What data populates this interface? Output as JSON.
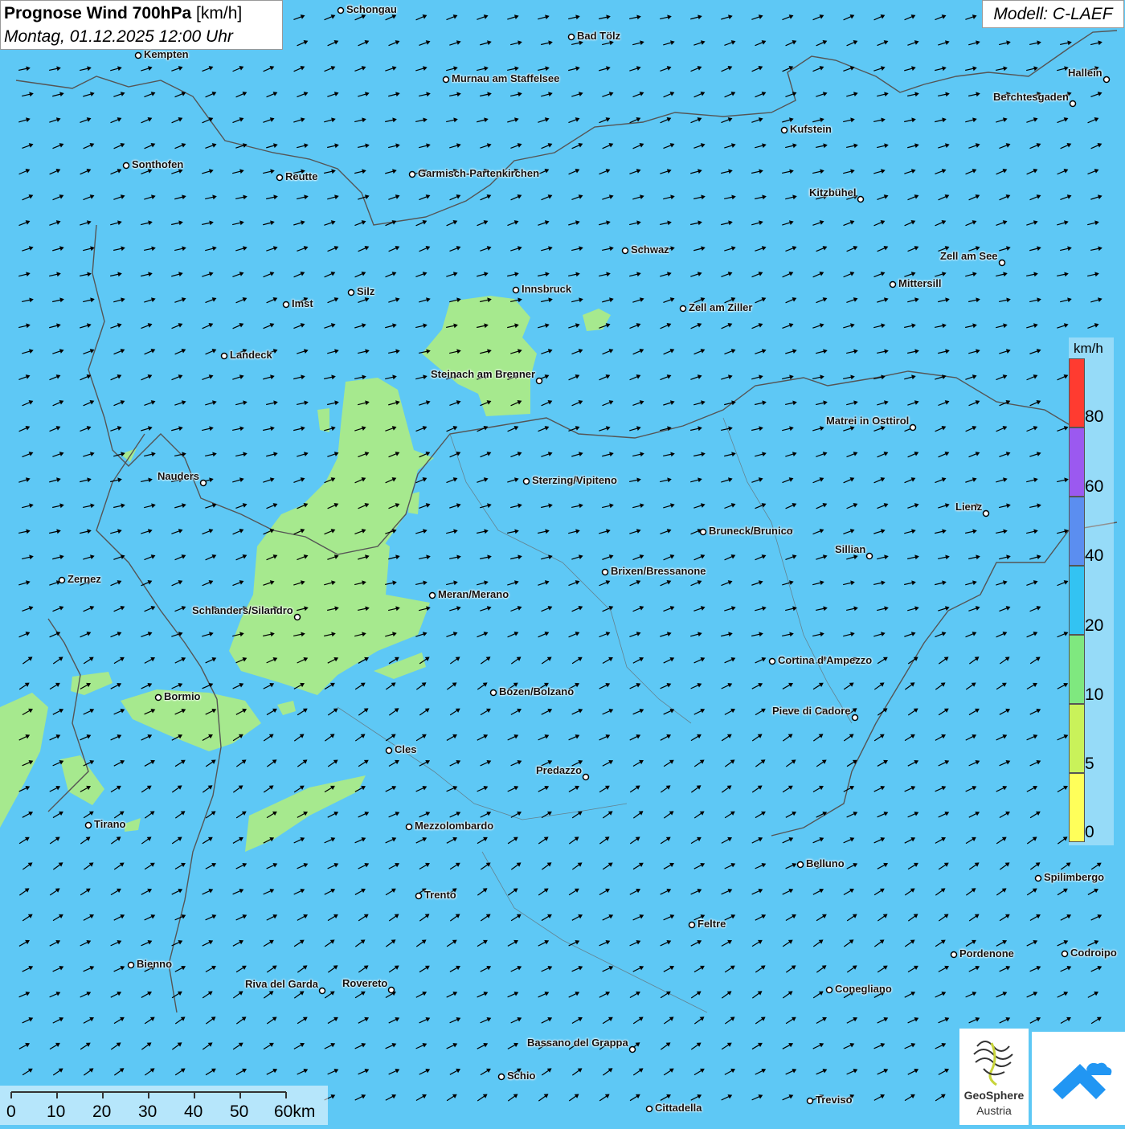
{
  "title": {
    "main_bold": "Prognose Wind 700hPa",
    "main_unit": " [km/h]",
    "subtitle": "Montag, 01.12.2025 12:00 Uhr"
  },
  "model": "Modell: C-LAEF",
  "legend": {
    "unit": "km/h",
    "colors": [
      "#ff3b30",
      "#9b59f0",
      "#5b8ef0",
      "#33c3f2",
      "#7fe87f",
      "#c9f25a",
      "#ffff5a"
    ],
    "ticks": [
      "80",
      "60",
      "40",
      "20",
      "10",
      "5",
      "0"
    ]
  },
  "scale": {
    "labels": [
      "0",
      "10",
      "20",
      "30",
      "40",
      "50",
      "60km"
    ]
  },
  "logo": {
    "name_line1": "GeoSphere",
    "name_line2": "Austria"
  },
  "colors": {
    "sea_blue": "#5ec8f5",
    "light_green": "#a6e98e",
    "border": "#555555",
    "arrow": "#000000"
  },
  "cities": [
    {
      "name": "Schongau",
      "side": "r"
    },
    {
      "name": "Bad Tölz",
      "side": "r"
    },
    {
      "name": "Kempten",
      "side": "r"
    },
    {
      "name": "Murnau am Staffelsee",
      "side": "r"
    },
    {
      "name": "Hallein",
      "side": "l"
    },
    {
      "name": "Berchtesgaden",
      "side": "l"
    },
    {
      "name": "Kufstein",
      "side": "r"
    },
    {
      "name": "Sonthofen",
      "side": "r"
    },
    {
      "name": "Reutte",
      "side": "r"
    },
    {
      "name": "Garmisch-Partenkirchen",
      "side": "r"
    },
    {
      "name": "Kitzbühel",
      "side": "l"
    },
    {
      "name": "Schwaz",
      "side": "r"
    },
    {
      "name": "Zell am See",
      "side": "l"
    },
    {
      "name": "Mittersill",
      "side": "r"
    },
    {
      "name": "Innsbruck",
      "side": "r"
    },
    {
      "name": "Silz",
      "side": "r"
    },
    {
      "name": "Imst",
      "side": "r"
    },
    {
      "name": "Zell am Ziller",
      "side": "r"
    },
    {
      "name": "Landeck",
      "side": "r"
    },
    {
      "name": "Steinach am Brenner",
      "side": "l"
    },
    {
      "name": "Matrei in Osttirol",
      "side": "l"
    },
    {
      "name": "Nauders",
      "side": "l"
    },
    {
      "name": "Sterzing/Vipiteno",
      "side": "r"
    },
    {
      "name": "Lienz",
      "side": "l"
    },
    {
      "name": "Bruneck/Brunico",
      "side": "r"
    },
    {
      "name": "Sillian",
      "side": "l"
    },
    {
      "name": "Brixen/Bressanone",
      "side": "r"
    },
    {
      "name": "Zernez",
      "side": "r"
    },
    {
      "name": "Meran/Merano",
      "side": "r"
    },
    {
      "name": "Schlanders/Silandro",
      "side": "l"
    },
    {
      "name": "Cortina d'Ampezzo",
      "side": "r"
    },
    {
      "name": "Bozen/Bolzano",
      "side": "r"
    },
    {
      "name": "Bormio",
      "side": "r"
    },
    {
      "name": "Pieve di Cadore",
      "side": "l"
    },
    {
      "name": "Cles",
      "side": "r"
    },
    {
      "name": "Predazzo",
      "side": "l"
    },
    {
      "name": "Tirano",
      "side": "r"
    },
    {
      "name": "Mezzolombardo",
      "side": "r"
    },
    {
      "name": "Belluno",
      "side": "r"
    },
    {
      "name": "Spilimbergo",
      "side": "r"
    },
    {
      "name": "Trento",
      "side": "r"
    },
    {
      "name": "Feltre",
      "side": "r"
    },
    {
      "name": "Pordenone",
      "side": "r"
    },
    {
      "name": "Codroipo",
      "side": "r"
    },
    {
      "name": "Bienno",
      "side": "r"
    },
    {
      "name": "Riva del Garda",
      "side": "l"
    },
    {
      "name": "Rovereto",
      "side": "l"
    },
    {
      "name": "Conegliano",
      "side": "r"
    },
    {
      "name": "Bassano del Grappa",
      "side": "l"
    },
    {
      "name": "Schio",
      "side": "r"
    },
    {
      "name": "Treviso",
      "side": "r"
    },
    {
      "name": "Cittadella",
      "side": "r"
    }
  ]
}
